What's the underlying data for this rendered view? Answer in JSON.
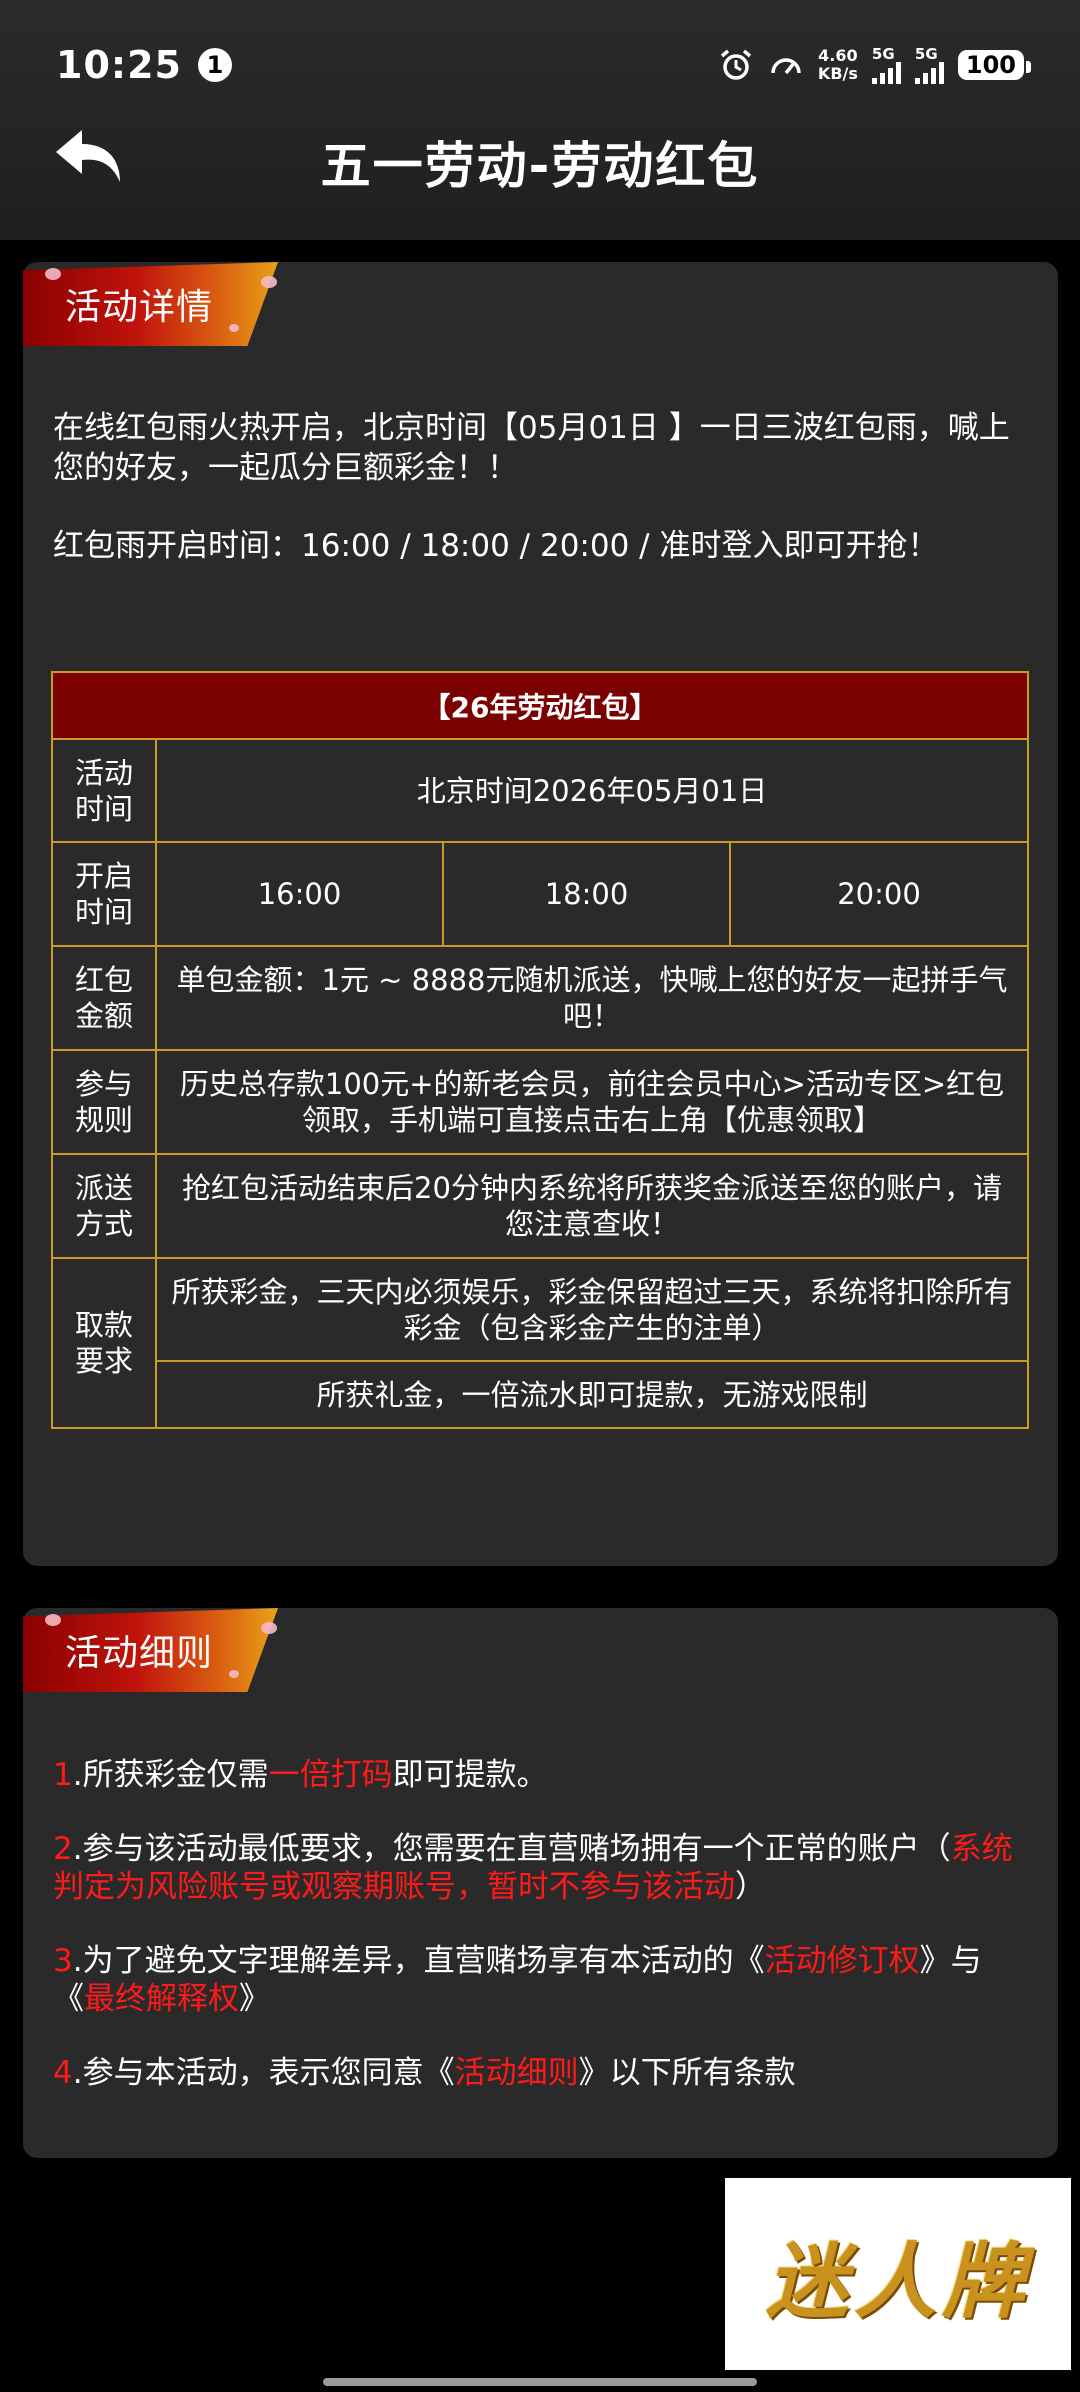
{
  "status_bar": {
    "time": "10:25",
    "notification_count": "1",
    "net_speed_value": "4.60",
    "net_speed_unit": "KB/s",
    "signal1_type": "5G",
    "signal2_type": "5G",
    "battery": "100"
  },
  "header": {
    "title": "五一劳动-劳动红包"
  },
  "details": {
    "ribbon_label": "活动详情",
    "intro_lines": [
      "在线红包雨火热开启，北京时间【05月01日 】一日三波红包雨，喊上您的好友，一起瓜分巨额彩金！！",
      "红包雨开启时间：16:00 / 18:00 / 20:00 / 准时登入即可开抢！"
    ],
    "table": {
      "title": "【26年劳动红包】",
      "rows": [
        {
          "label": "活动时间",
          "value": "北京时间2026年05月01日"
        },
        {
          "label": "开启时间",
          "times": [
            "16:00",
            "18:00",
            "20:00"
          ]
        },
        {
          "label": "红包金额",
          "value": "单包金额：1元 ~ 8888元随机派送，快喊上您的好友一起拼手气吧！"
        },
        {
          "label": "参与规则",
          "value": "历史总存款100元+的新老会员，前往会员中心>活动专区>红包领取，手机端可直接点击右上角【优惠领取】"
        },
        {
          "label": "派送方式",
          "value": "抢红包活动结束后20分钟内系统将所获奖金派送至您的账户，请您注意查收！"
        },
        {
          "label": "取款要求",
          "values": [
            "所获彩金，三天内必须娱乐，彩金保留超过三天，系统将扣除所有彩金（包含彩金产生的注单）",
            "所获礼金，一倍流水即可提款，无游戏限制"
          ]
        }
      ]
    }
  },
  "rules_section": {
    "ribbon_label": "活动细则",
    "rules": [
      {
        "num": "1",
        "before": ".所获彩金仅需",
        "highlight": "一倍打码",
        "after": "即可提款。"
      },
      {
        "num": "2",
        "before": ".参与该活动最低要求，您需要在直营赌场拥有一个正常的账户（",
        "highlight": "系统判定为风险账号或观察期账号，暂时不参与该活动",
        "after": "）"
      },
      {
        "num": "3",
        "before": ".为了避免文字理解差异，直营赌场享有本活动的《",
        "highlight": "活动修订权",
        "middle": "》与《",
        "highlight2": "最终解释权",
        "after": "》"
      },
      {
        "num": "4",
        "before": ".参与本活动，表示您同意《",
        "highlight": "活动细则",
        "after": "》以下所有条款"
      }
    ]
  },
  "watermark": {
    "text": "迷人牌"
  },
  "colors": {
    "page_bg": "#000000",
    "card_bg": "#2a2a2a",
    "table_head_bg": "#7b0000",
    "table_border": "#c89b22",
    "highlight_red": "#ff1a1a"
  }
}
